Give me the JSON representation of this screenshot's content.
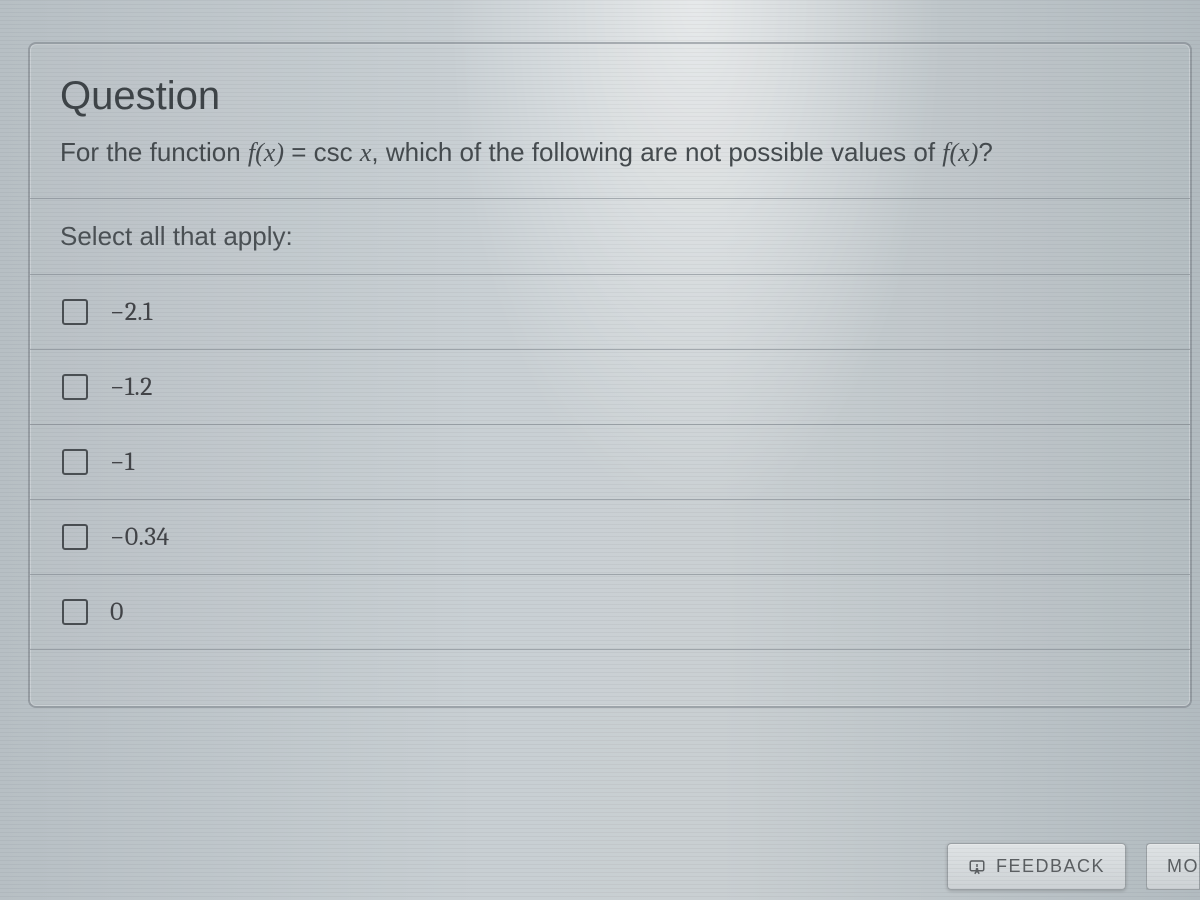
{
  "question": {
    "heading": "Question",
    "prompt_pre": "For the function ",
    "prompt_fn1": "f(x)",
    "prompt_eq": " = csc ",
    "prompt_var": "x",
    "prompt_mid": ", which of the following are not possible values of ",
    "prompt_fn2": "f(x)",
    "prompt_post": "?",
    "instruction": "Select all that apply:",
    "options": [
      {
        "label": "−2.1"
      },
      {
        "label": "−1.2"
      },
      {
        "label": "−1"
      },
      {
        "label": "−0.34"
      },
      {
        "label": "0"
      }
    ]
  },
  "buttons": {
    "feedback": "FEEDBACK",
    "more_partial": "MO"
  }
}
